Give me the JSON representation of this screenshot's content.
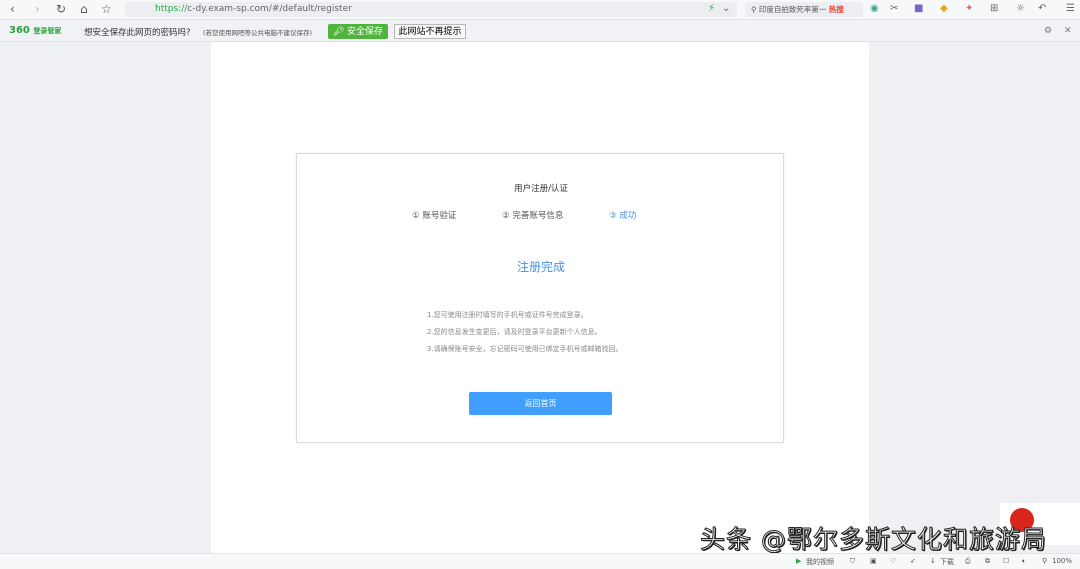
{
  "browser": {
    "url_scheme": "https://",
    "url_rest": "c-dy.exam-sp.com/#/default/register",
    "search_text": "印度自拍致死率第一",
    "search_hot": "热搜",
    "zoom": "100%",
    "my_video": "我的视频",
    "download": "下载"
  },
  "password_bar": {
    "logo": "360",
    "logo_sub": "登录管家",
    "question": "想安全保存此网页的密码吗?",
    "hint": "(若您使用网吧等公共电脑不建议保存)",
    "save": "安全保存",
    "no_prompt": "此网站不再提示"
  },
  "card": {
    "title": "用户注册/认证",
    "steps": [
      "① 账号验证",
      "② 完善账号信息",
      "③ 成功"
    ],
    "active_step": 3,
    "done": "注册完成",
    "tips": [
      "1.您可使用注册时填写的手机号或证件号完成登录。",
      "2.您的信息发生变更后，请及时登录平台更新个人信息。",
      "3.请确保账号安全，忘记密码可使用已绑定手机号或邮箱找回。"
    ],
    "button": "返回首页"
  },
  "watermark": "头条 @鄂尔多斯文化和旅游局",
  "colors": {
    "accent": "#409eff",
    "green": "#4fb43c"
  }
}
